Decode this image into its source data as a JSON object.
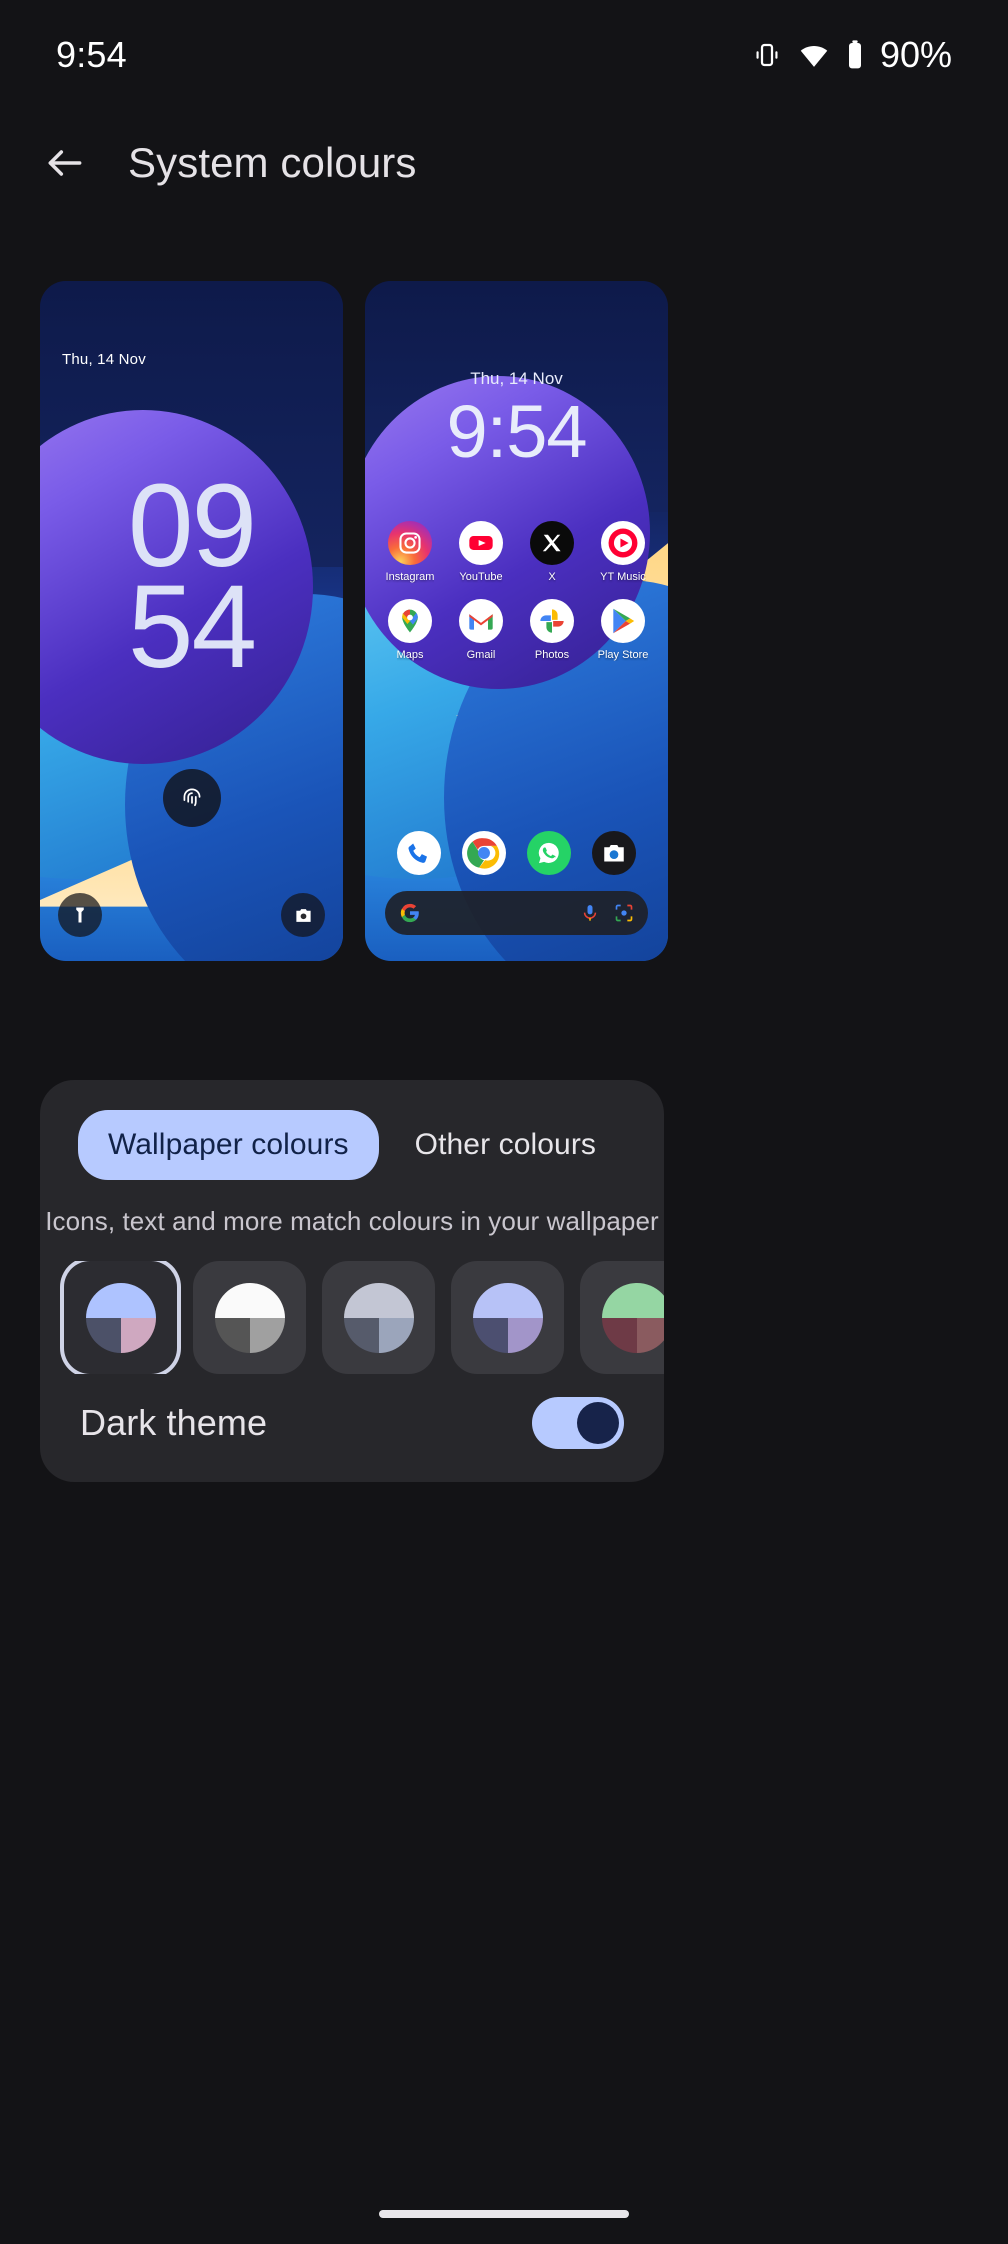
{
  "status_bar": {
    "time": "9:54",
    "battery_percent": "90%",
    "icons": [
      "vibrate-icon",
      "wifi-icon",
      "battery-icon"
    ]
  },
  "header": {
    "back_icon": "back-arrow-icon",
    "title": "System colours"
  },
  "previews": {
    "lock_screen": {
      "date": "Thu, 14 Nov",
      "clock_hours": "09",
      "clock_minutes": "54",
      "fingerprint_icon": "fingerprint-icon",
      "shortcut_left": "flashlight-icon",
      "shortcut_right": "camera-icon"
    },
    "home_screen": {
      "date": "Thu, 14 Nov",
      "clock": "9:54",
      "apps_row1": [
        {
          "label": "Instagram",
          "icon": "instagram-icon"
        },
        {
          "label": "YouTube",
          "icon": "youtube-icon"
        },
        {
          "label": "X",
          "icon": "x-twitter-icon"
        },
        {
          "label": "YT Music",
          "icon": "youtube-music-icon"
        }
      ],
      "apps_row2": [
        {
          "label": "Maps",
          "icon": "google-maps-icon"
        },
        {
          "label": "Gmail",
          "icon": "gmail-icon"
        },
        {
          "label": "Photos",
          "icon": "google-photos-icon"
        },
        {
          "label": "Play Store",
          "icon": "play-store-icon"
        }
      ],
      "dock": [
        {
          "label": "Phone",
          "icon": "phone-icon"
        },
        {
          "label": "Chrome",
          "icon": "chrome-icon"
        },
        {
          "label": "WhatsApp",
          "icon": "whatsapp-icon"
        },
        {
          "label": "Camera",
          "icon": "camera-icon"
        }
      ],
      "search_bar": {
        "google_icon": "google-g-icon",
        "mic_icon": "microphone-icon",
        "lens_icon": "google-lens-icon"
      }
    }
  },
  "options_card": {
    "tabs": [
      {
        "label": "Wallpaper colours",
        "selected": true
      },
      {
        "label": "Other colours",
        "selected": false
      }
    ],
    "description": "Icons, text and more match colours in your wallpaper",
    "accent_selected": "#b7caff",
    "swatches": [
      {
        "name": "swatch-1",
        "selected": true,
        "top": "#aec3ff",
        "bottom_left": "#4c5168",
        "bottom_right": "#cfa8c0"
      },
      {
        "name": "swatch-2",
        "selected": false,
        "top": "#fafafa",
        "bottom_left": "#555555",
        "bottom_right": "#a0a0a0"
      },
      {
        "name": "swatch-3",
        "selected": false,
        "top": "#c3c6d4",
        "bottom_left": "#565b6b",
        "bottom_right": "#9ba5bb"
      },
      {
        "name": "swatch-4",
        "selected": false,
        "top": "#b7c2f7",
        "bottom_left": "#4c4f70",
        "bottom_right": "#a295c9"
      },
      {
        "name": "swatch-5",
        "selected": false,
        "top": "#95d6a3",
        "bottom_left": "#6e3a46",
        "bottom_right": "#8a5b5f"
      }
    ],
    "dark_theme": {
      "label": "Dark theme",
      "enabled": true
    }
  },
  "nav_pill": "home-gesture-bar"
}
